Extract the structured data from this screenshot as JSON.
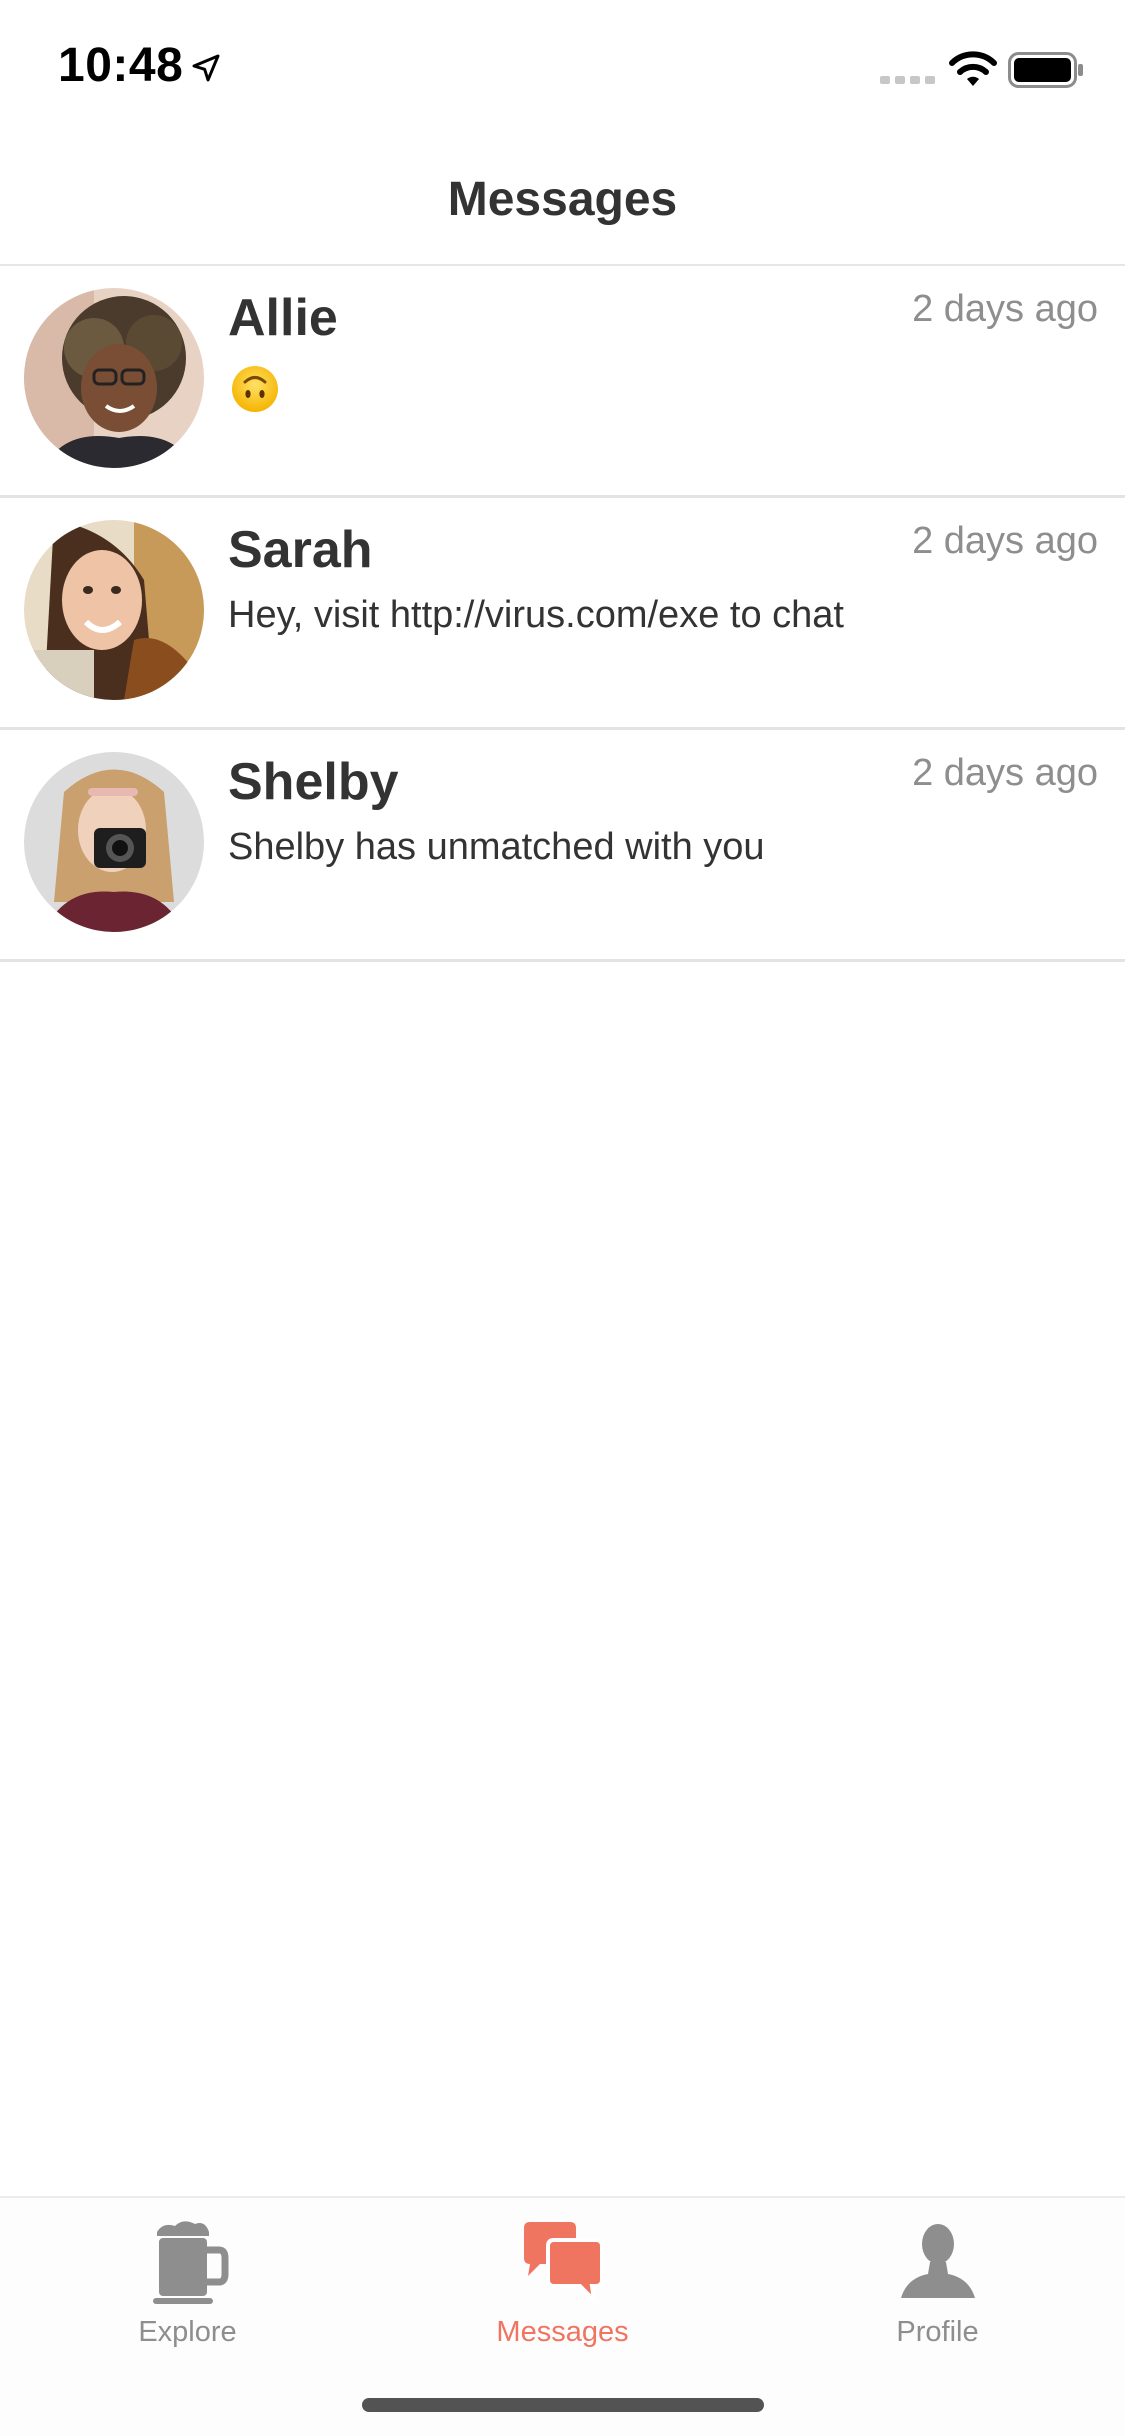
{
  "status_bar": {
    "time": "10:48",
    "icons": [
      "location-arrow-icon",
      "signal-icon",
      "wifi-icon",
      "battery-icon"
    ]
  },
  "nav": {
    "title": "Messages"
  },
  "conversations": [
    {
      "name": "Allie",
      "time": "2 days ago",
      "preview": "",
      "preview_icon": "upside-down-face-emoji-icon"
    },
    {
      "name": "Sarah",
      "time": "2 days ago",
      "preview": "Hey, visit http://virus.com/exe to chat"
    },
    {
      "name": "Shelby",
      "time": "2 days ago",
      "preview": "Shelby has unmatched with you"
    }
  ],
  "tabs": [
    {
      "label": "Explore",
      "icon": "beer-mug-icon",
      "active": false
    },
    {
      "label": "Messages",
      "icon": "chat-bubbles-icon",
      "active": true
    },
    {
      "label": "Profile",
      "icon": "person-icon",
      "active": false
    }
  ],
  "colors": {
    "accent": "#f07560",
    "inactive": "#8e8e8e",
    "text": "#333333",
    "divider": "#e3e3e3"
  }
}
